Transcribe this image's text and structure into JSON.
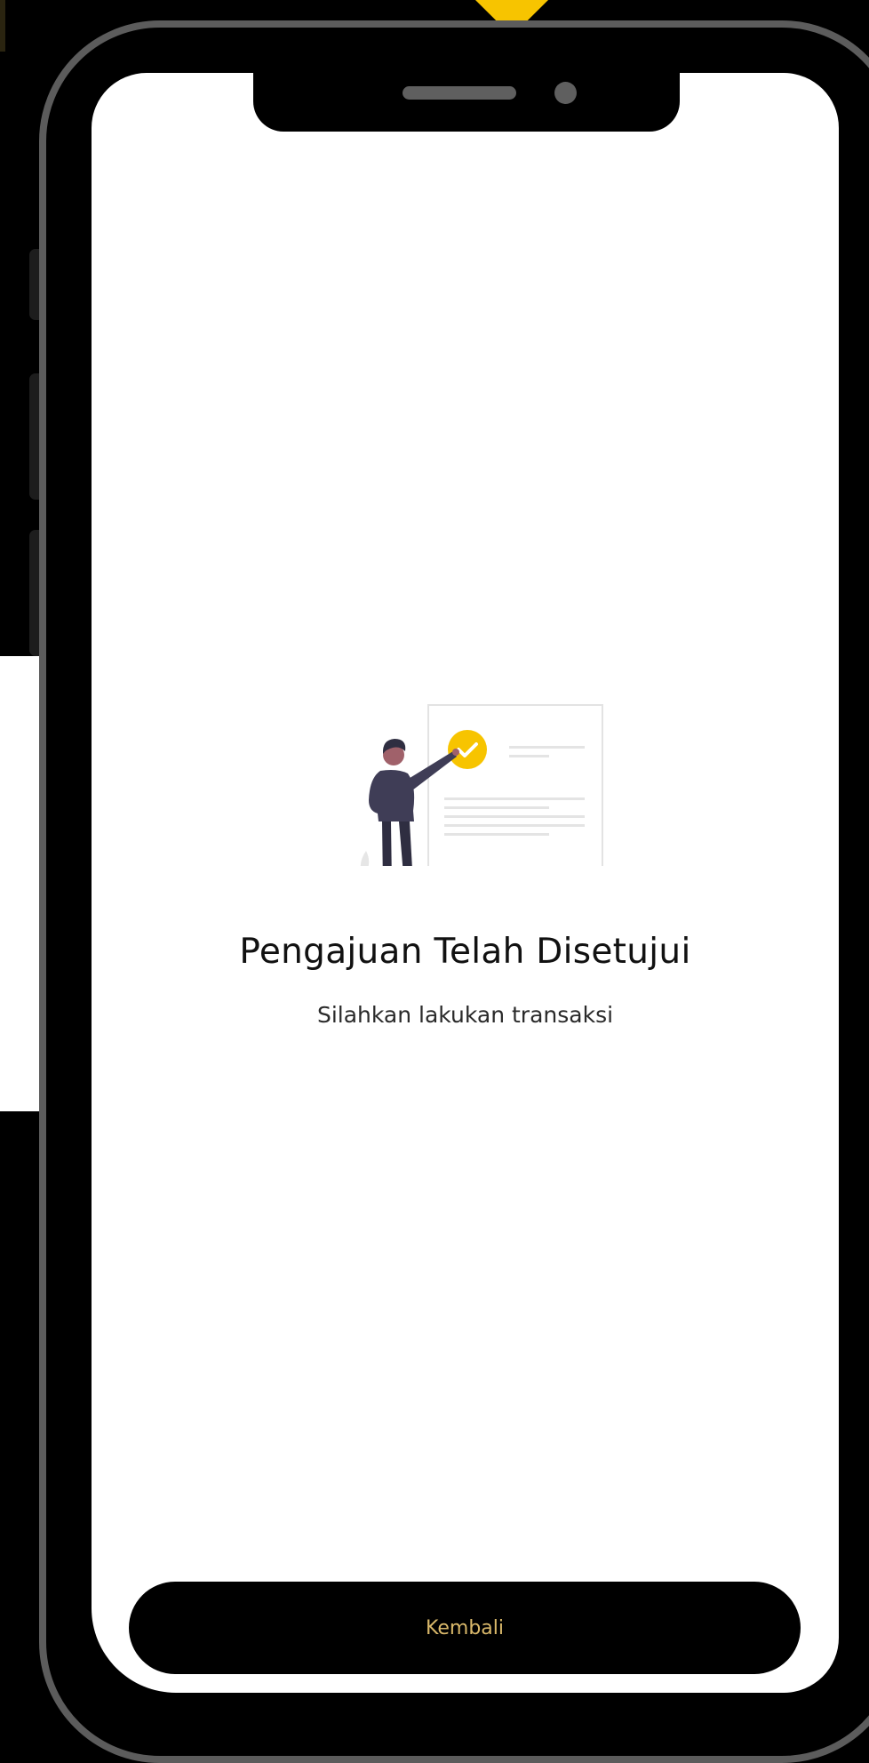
{
  "screen": {
    "title": "Pengajuan Telah Disetujui",
    "subtitle": "Silahkan lakukan transaksi"
  },
  "actions": {
    "back_label": "Kembali"
  },
  "illustration": {
    "icon": "approved-document-illustration",
    "check_icon": "check-circle-icon"
  },
  "colors": {
    "accent": "#F7C400",
    "button_bg": "#000000",
    "button_text": "#D9B86A",
    "frame": "#5C5C5C",
    "figure": "#3F3D56"
  }
}
